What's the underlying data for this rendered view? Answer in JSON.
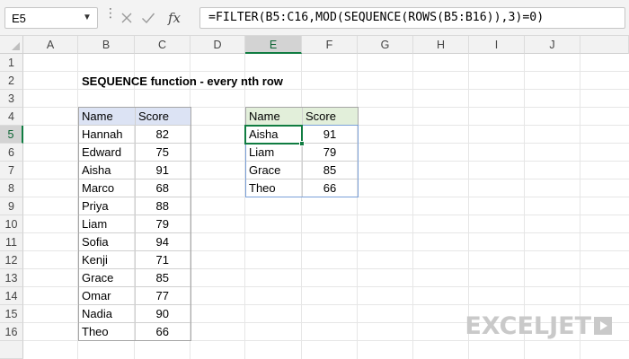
{
  "name_box": {
    "value": "E5"
  },
  "formula_bar": {
    "formula": "=FILTER(B5:C16,MOD(SEQUENCE(ROWS(B5:B16)),3)=0)",
    "icons": [
      "cancel-icon",
      "enter-icon",
      "fx-icon"
    ]
  },
  "columns": [
    "A",
    "B",
    "C",
    "D",
    "E",
    "F",
    "G",
    "H",
    "I",
    "J"
  ],
  "active_column": "E",
  "rows": [
    "1",
    "2",
    "3",
    "4",
    "5",
    "6",
    "7",
    "8",
    "9",
    "10",
    "11",
    "12",
    "13",
    "14",
    "15",
    "16"
  ],
  "active_row": "5",
  "title": "SEQUENCE function - every nth row",
  "source_table": {
    "headers": [
      "Name",
      "Score"
    ],
    "rows": [
      [
        "Hannah",
        "82"
      ],
      [
        "Edward",
        "75"
      ],
      [
        "Aisha",
        "91"
      ],
      [
        "Marco",
        "68"
      ],
      [
        "Priya",
        "88"
      ],
      [
        "Liam",
        "79"
      ],
      [
        "Sofia",
        "94"
      ],
      [
        "Kenji",
        "71"
      ],
      [
        "Grace",
        "85"
      ],
      [
        "Omar",
        "77"
      ],
      [
        "Nadia",
        "90"
      ],
      [
        "Theo",
        "66"
      ]
    ],
    "header_color": "#dce3f4"
  },
  "result_table": {
    "headers": [
      "Name",
      "Score"
    ],
    "rows": [
      [
        "Aisha",
        "91"
      ],
      [
        "Liam",
        "79"
      ],
      [
        "Grace",
        "85"
      ],
      [
        "Theo",
        "66"
      ]
    ],
    "header_color": "#e2efda"
  },
  "accent_color": "#107c41",
  "logo": {
    "text": "EXCELJET"
  }
}
